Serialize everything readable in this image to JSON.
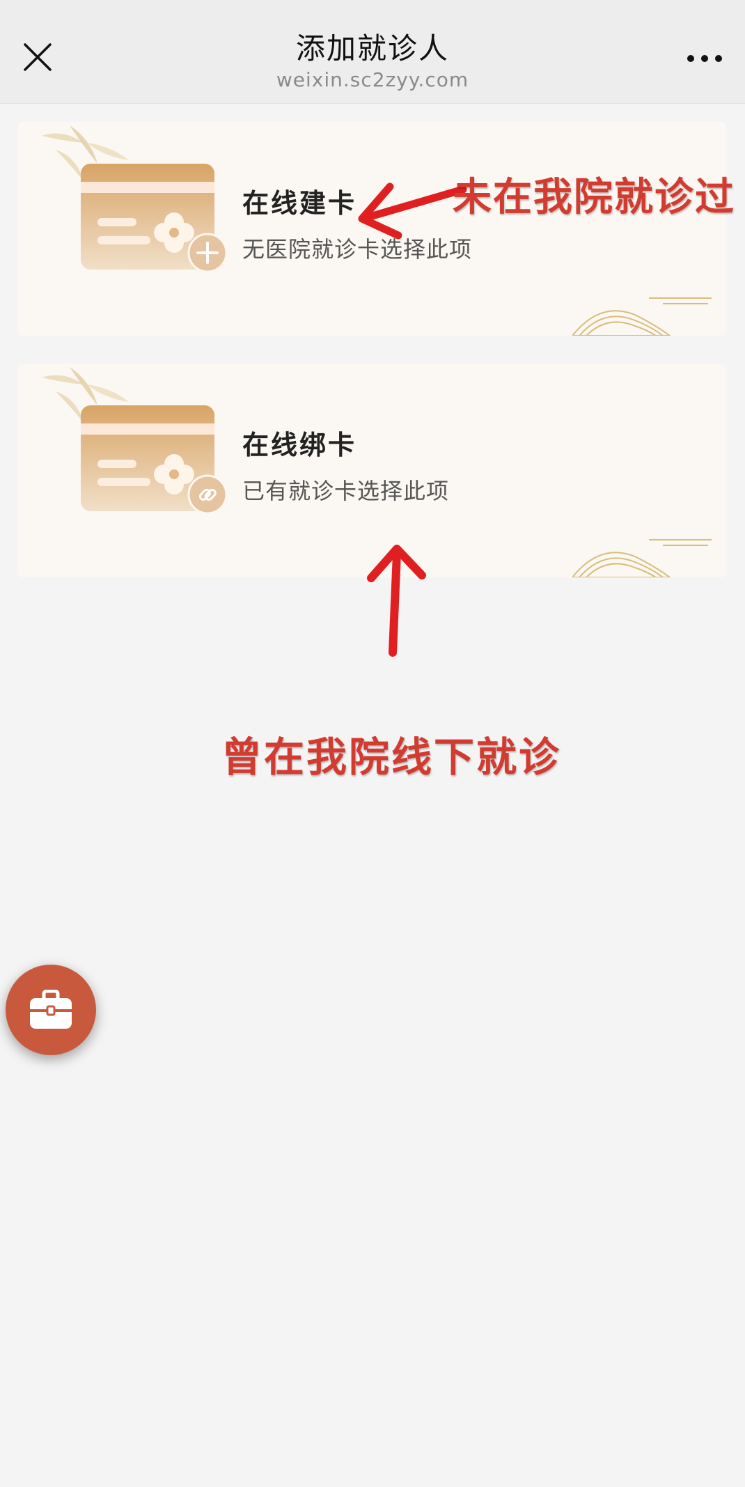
{
  "navbar": {
    "title": "添加就诊人",
    "subtitle": "weixin.sc2zyy.com",
    "close_icon": "close-icon",
    "more_icon": "more-icon"
  },
  "options": [
    {
      "title": "在线建卡",
      "desc": "无医院就诊卡选择此项",
      "icon": "card-add-icon"
    },
    {
      "title": "在线绑卡",
      "desc": "已有就诊卡选择此项",
      "icon": "card-link-icon"
    }
  ],
  "annotations": {
    "first": "未在我院就诊过",
    "second": "曾在我院线下就诊",
    "color": "#d23b30"
  },
  "fab": {
    "icon": "briefcase-icon",
    "color": "#c9593d"
  }
}
